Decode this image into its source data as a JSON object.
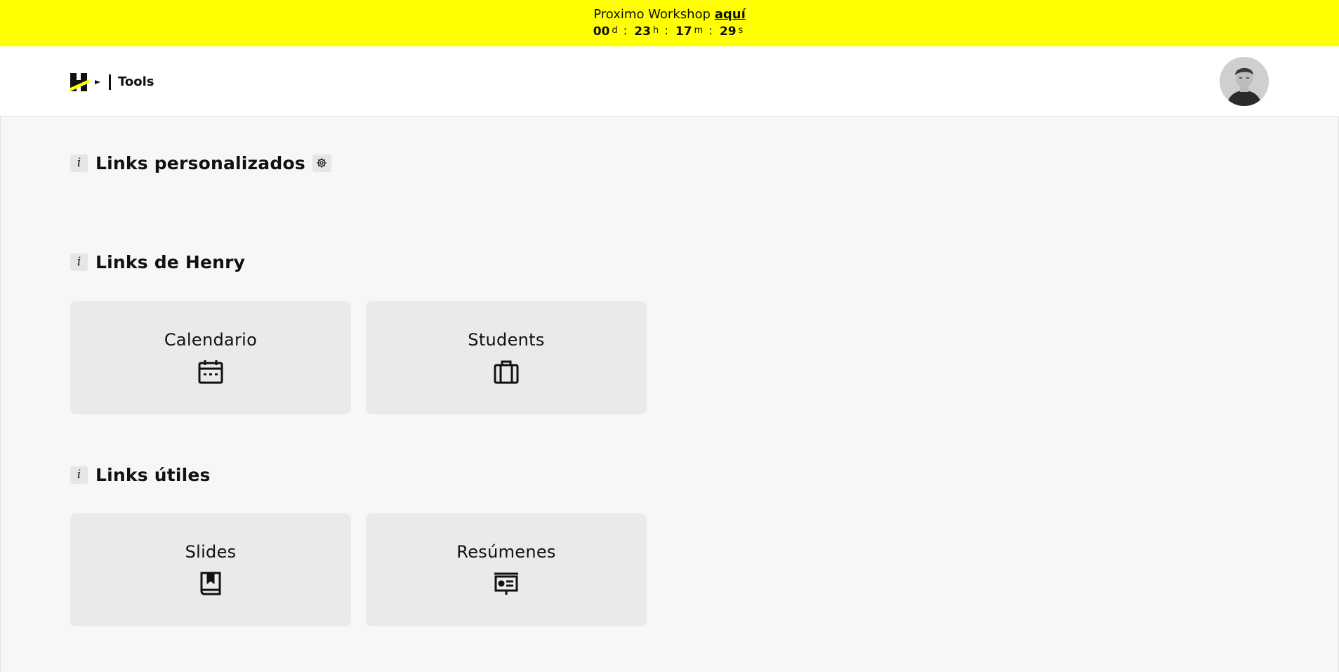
{
  "banner": {
    "text": "Proximo Workshop",
    "link": "aquí",
    "countdown": {
      "days": "00",
      "days_unit": "d",
      "hours": "23",
      "hours_unit": "h",
      "minutes": "17",
      "minutes_unit": "m",
      "seconds": "29",
      "seconds_unit": "s",
      "separator": ":"
    },
    "background": "#ffff01"
  },
  "header": {
    "title": "Tools",
    "logo_icon": "henry-logo-icon",
    "avatar_icon": "user-avatar"
  },
  "sections": {
    "custom": {
      "title": "Links personalizados",
      "info": "i",
      "settings_icon": "gear-icon"
    },
    "henry": {
      "title": "Links de Henry",
      "info": "i",
      "cards": [
        {
          "label": "Calendario",
          "icon": "calendar-icon"
        },
        {
          "label": "Students",
          "icon": "briefcase-icon"
        }
      ]
    },
    "useful": {
      "title": "Links útiles",
      "info": "i",
      "cards": [
        {
          "label": "Slides",
          "icon": "book-icon"
        },
        {
          "label": "Resúmenes",
          "icon": "presentation-icon"
        }
      ]
    }
  }
}
